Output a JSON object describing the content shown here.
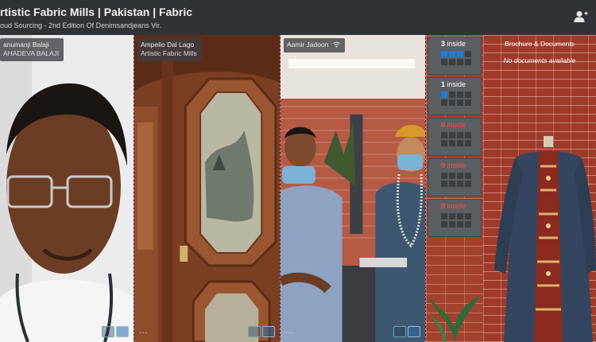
{
  "header": {
    "title": "rtistic Fabric Mills | Pakistan | Fabric",
    "subtitle": "oud Sourcing - 2nd Edition Of Denimsandjeans Vir."
  },
  "participants": [
    {
      "name": "anumanji Balaji",
      "org": "AHADEVA BALAJI"
    },
    {
      "name": "Ampelio Dal Lago",
      "org": "Artistic Fabric Mills"
    },
    {
      "name": "Aamir Jadoon",
      "org": ""
    }
  ],
  "tile_more": "...",
  "rooms": [
    {
      "count": "3",
      "word": "inside",
      "active": 3
    },
    {
      "count": "1",
      "word": "inside",
      "active": 1
    },
    {
      "count": "0",
      "word": "inside",
      "active": 0
    },
    {
      "count": "0",
      "word": "inside",
      "active": 0
    },
    {
      "count": "0",
      "word": "inside",
      "active": 0
    }
  ],
  "brochure": {
    "title": "Brochure & Documents",
    "empty": "No documents available"
  },
  "colors": {
    "seat_active": "#1e7bd6",
    "zero_count": "#ff4b4b",
    "brick": "#a1412e"
  }
}
